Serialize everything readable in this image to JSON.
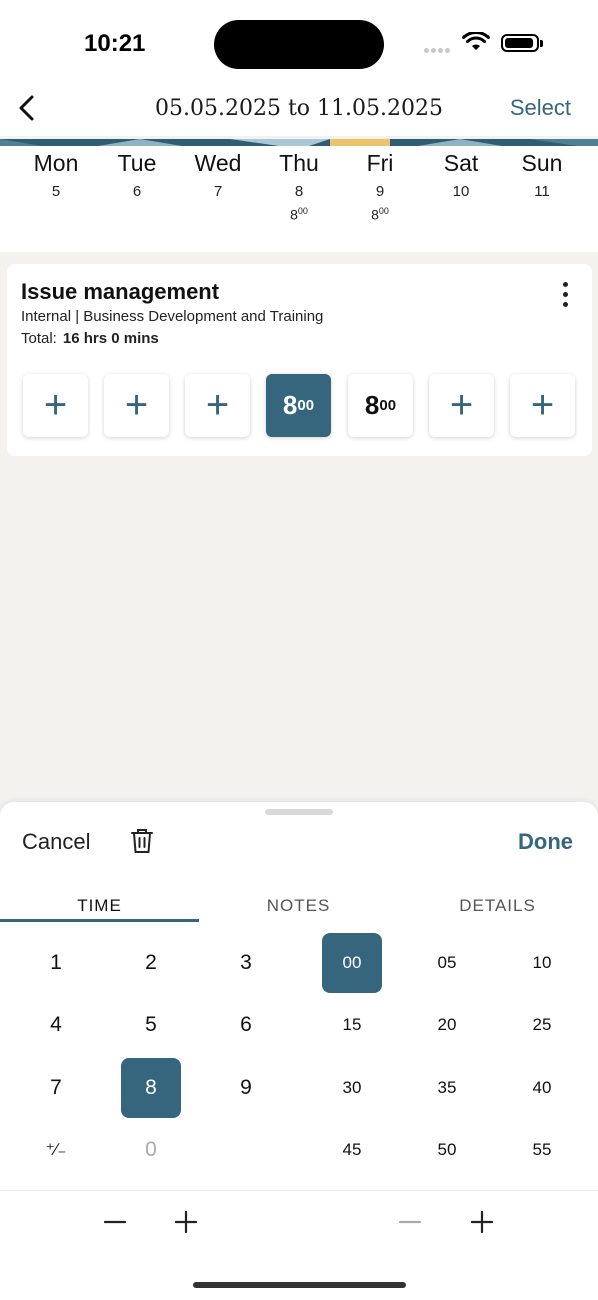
{
  "status_bar": {
    "time": "10:21"
  },
  "header": {
    "date_range": "05.05.2025 to 11.05.2025",
    "select_label": "Select"
  },
  "week": [
    {
      "name": "Mon",
      "date": "5",
      "hours": "",
      "hours_sup": ""
    },
    {
      "name": "Tue",
      "date": "6",
      "hours": "",
      "hours_sup": ""
    },
    {
      "name": "Wed",
      "date": "7",
      "hours": "",
      "hours_sup": ""
    },
    {
      "name": "Thu",
      "date": "8",
      "hours": "8",
      "hours_sup": "00"
    },
    {
      "name": "Fri",
      "date": "9",
      "hours": "8",
      "hours_sup": "00"
    },
    {
      "name": "Sat",
      "date": "10",
      "hours": "",
      "hours_sup": ""
    },
    {
      "name": "Sun",
      "date": "11",
      "hours": "",
      "hours_sup": ""
    }
  ],
  "card": {
    "title": "Issue management",
    "subtitle": "Internal | Business Development and Training",
    "total_label": "Total:",
    "total_value": "16 hrs 0 mins",
    "cells": [
      {
        "type": "add",
        "symbol": "+"
      },
      {
        "type": "add",
        "symbol": "+"
      },
      {
        "type": "add",
        "symbol": "+"
      },
      {
        "type": "value",
        "hours": "8",
        "sup": "00",
        "active": true
      },
      {
        "type": "value",
        "hours": "8",
        "sup": "00",
        "active": false
      },
      {
        "type": "add",
        "symbol": "+"
      },
      {
        "type": "add",
        "symbol": "+"
      }
    ]
  },
  "sheet": {
    "cancel_label": "Cancel",
    "done_label": "Done",
    "tabs": [
      "TIME",
      "NOTES",
      "DETAILS"
    ],
    "active_tab": "TIME",
    "hour_keys": [
      "1",
      "2",
      "3",
      "4",
      "5",
      "6",
      "7",
      "8",
      "9",
      "⁺∕₋",
      "0"
    ],
    "selected_hour": "8",
    "minute_keys": [
      "00",
      "05",
      "10",
      "15",
      "20",
      "25",
      "30",
      "35",
      "40",
      "45",
      "50",
      "55"
    ],
    "selected_minute": "00",
    "hour_minus": "−",
    "hour_plus": "+",
    "minute_minus": "−",
    "minute_plus": "+"
  },
  "colors": {
    "accent": "#35667e",
    "background": "#f3f2ef",
    "strip_yellow": "#e9c46a"
  }
}
